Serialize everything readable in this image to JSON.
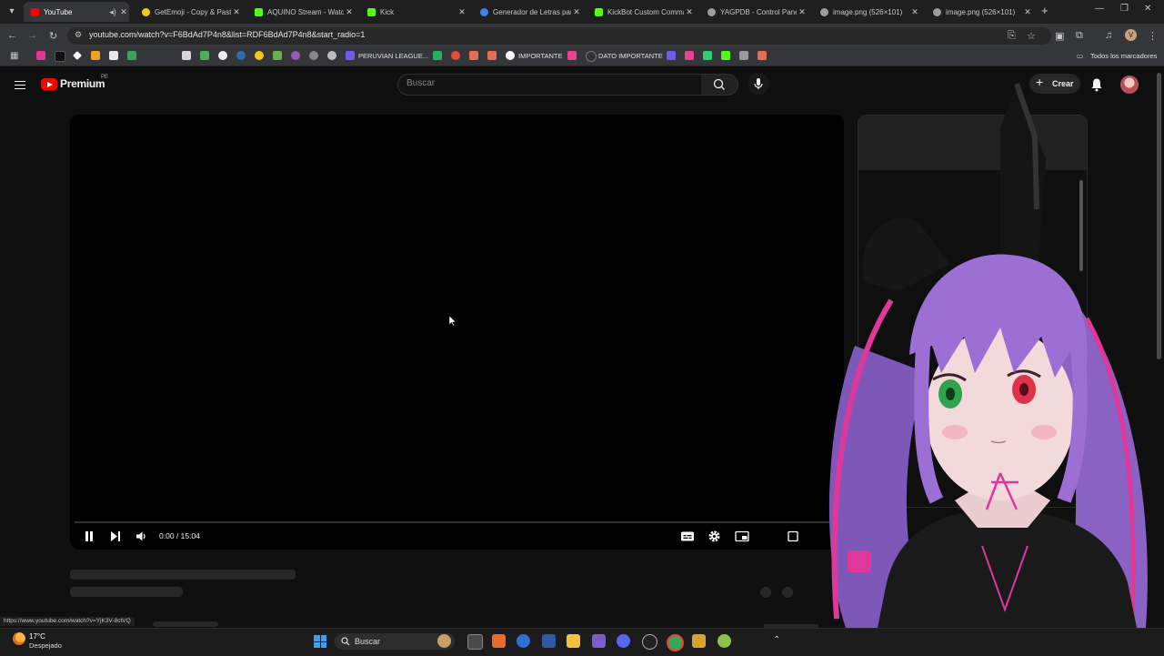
{
  "browser": {
    "tabs": [
      {
        "title": "YouTube",
        "favicon_color": "#ff0000",
        "active": true
      },
      {
        "title": "GetEmoji - Copy & Paste",
        "favicon_color": "#f5c518"
      },
      {
        "title": "AQUINO Stream - Watch",
        "favicon_color": "#53fc18"
      },
      {
        "title": "Kick",
        "favicon_color": "#53fc18"
      },
      {
        "title": "Generador de Letras para",
        "favicon_color": "#3b82f6"
      },
      {
        "title": "KickBot Custom Comma",
        "favicon_color": "#53fc18"
      },
      {
        "title": "YAGPDB - Control Panel",
        "favicon_color": "#9e9e9e"
      },
      {
        "title": "image.png (526×101)",
        "favicon_color": "#9e9e9e"
      },
      {
        "title": "image.png (526×101)",
        "favicon_color": "#9e9e9e"
      }
    ],
    "url": "youtube.com/watch?v=F6BdAd7P4n8&list=RDF6BdAd7P4n8&start_radio=1",
    "bookmarks": {
      "peruvian_league": "PERUVIAN LEAGUE...",
      "importante": "IMPORTANTE",
      "dato_importante": "DATO IMPORTANTE",
      "all_bookmarks": "Todos los marcadores"
    },
    "profile_initial": "V",
    "status_url": "https://www.youtube.com/watch?v=YjK3V-8ctVQ"
  },
  "youtube": {
    "brand": "Premium",
    "country_code": "PE",
    "search_placeholder": "Buscar",
    "create_label": "Crear",
    "player": {
      "time_display": "0:00 / 15:04",
      "playing": true,
      "progress_fraction": 0.0
    }
  },
  "taskbar": {
    "temperature": "17°C",
    "weather": "Despejado",
    "search_label": "Buscar"
  },
  "colors": {
    "yt_red": "#ff0000",
    "hair_purple": "#9b6fd3",
    "hair_pink": "#e0379b"
  }
}
